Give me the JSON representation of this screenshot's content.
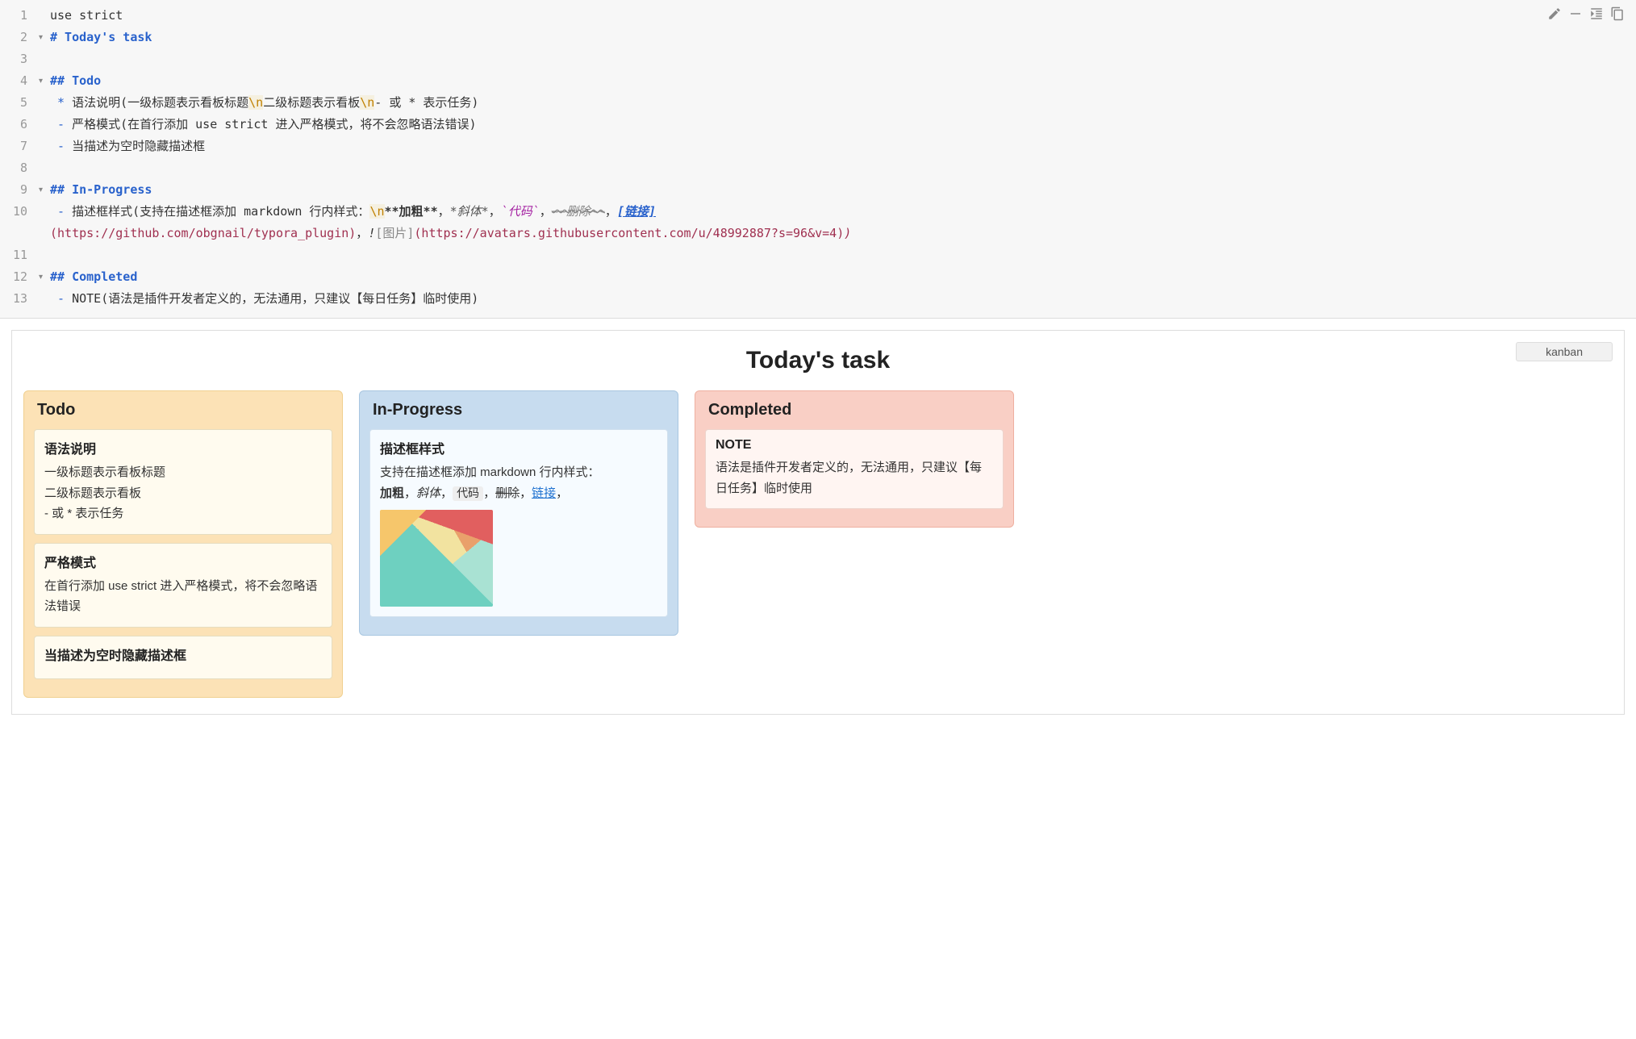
{
  "editor": {
    "lines": [
      {
        "num": "1",
        "fold": "",
        "segments": [
          {
            "cls": "tk-text",
            "t": "use strict"
          }
        ]
      },
      {
        "num": "2",
        "fold": "▾",
        "segments": [
          {
            "cls": "tk-header",
            "t": "# Today's task"
          }
        ]
      },
      {
        "num": "3",
        "fold": "",
        "segments": [
          {
            "cls": "tk-text",
            "t": ""
          }
        ]
      },
      {
        "num": "4",
        "fold": "▾",
        "segments": [
          {
            "cls": "tk-header",
            "t": "## Todo"
          }
        ]
      },
      {
        "num": "5",
        "fold": "",
        "segments": [
          {
            "cls": "tk-bullet",
            "t": " * "
          },
          {
            "cls": "tk-text",
            "t": "语法说明(一级标题表示看板标题"
          },
          {
            "cls": "tk-escape",
            "t": "\\n"
          },
          {
            "cls": "tk-text",
            "t": "二级标题表示看板"
          },
          {
            "cls": "tk-escape",
            "t": "\\n"
          },
          {
            "cls": "tk-text",
            "t": "- 或 * 表示任务)"
          }
        ]
      },
      {
        "num": "6",
        "fold": "",
        "segments": [
          {
            "cls": "tk-bullet",
            "t": " - "
          },
          {
            "cls": "tk-text",
            "t": "严格模式(在首行添加 use strict 进入严格模式，将不会忽略语法错误)"
          }
        ]
      },
      {
        "num": "7",
        "fold": "",
        "segments": [
          {
            "cls": "tk-bullet",
            "t": " - "
          },
          {
            "cls": "tk-text",
            "t": "当描述为空时隐藏描述框"
          }
        ]
      },
      {
        "num": "8",
        "fold": "",
        "segments": [
          {
            "cls": "tk-text",
            "t": ""
          }
        ]
      },
      {
        "num": "9",
        "fold": "▾",
        "segments": [
          {
            "cls": "tk-header",
            "t": "## In-Progress"
          }
        ]
      },
      {
        "num": "10",
        "fold": "",
        "segments": [
          {
            "cls": "tk-bullet",
            "t": " - "
          },
          {
            "cls": "tk-text",
            "t": "描述框样式(支持在描述框添加 markdown 行内样式："
          },
          {
            "cls": "tk-escape",
            "t": "\\n"
          },
          {
            "cls": "tk-bold",
            "t": "**加粗**"
          },
          {
            "cls": "tk-text",
            "t": "，"
          },
          {
            "cls": "tk-italic",
            "t": "*斜体*"
          },
          {
            "cls": "tk-text",
            "t": "，"
          },
          {
            "cls": "tk-code-inline",
            "t": "`代码`"
          },
          {
            "cls": "tk-text",
            "t": "，"
          },
          {
            "cls": "tk-strike",
            "t": "~~删除~~"
          },
          {
            "cls": "tk-text",
            "t": "，"
          },
          {
            "cls": "tk-link-label",
            "t": "[链接]"
          }
        ]
      },
      {
        "num": "",
        "fold": "",
        "segments": [
          {
            "cls": "tk-url",
            "t": "(https://github.com/obgnail/typora_plugin)"
          },
          {
            "cls": "tk-text",
            "t": "，"
          },
          {
            "cls": "tk-bang",
            "t": "!"
          },
          {
            "cls": "tk-img-label",
            "t": "[图片]"
          },
          {
            "cls": "tk-url",
            "t": "(https://avatars.githubusercontent.com/u/48992887?s=96&v=4)"
          },
          {
            "cls": "tk-paren",
            "t": ")"
          }
        ]
      },
      {
        "num": "11",
        "fold": "",
        "segments": [
          {
            "cls": "tk-text",
            "t": ""
          }
        ]
      },
      {
        "num": "12",
        "fold": "▾",
        "segments": [
          {
            "cls": "tk-header",
            "t": "## Completed"
          }
        ]
      },
      {
        "num": "13",
        "fold": "",
        "segments": [
          {
            "cls": "tk-bullet",
            "t": " - "
          },
          {
            "cls": "tk-text",
            "t": "NOTE(语法是插件开发者定义的，无法通用，只建议【每日任务】临时使用)"
          }
        ]
      }
    ]
  },
  "toolbar_icons": [
    "edit-icon",
    "minus-icon",
    "indent-icon",
    "copy-icon"
  ],
  "preview": {
    "badge": "kanban",
    "title": "Today's task",
    "columns": [
      {
        "key": "todo",
        "title": "Todo",
        "cards": [
          {
            "title": "语法说明",
            "body_lines": [
              "一级标题表示看板标题",
              "二级标题表示看板",
              "- 或 * 表示任务"
            ]
          },
          {
            "title": "严格模式",
            "body_lines": [
              "在首行添加 use strict 进入严格模式，将不会忽略语法错误"
            ]
          },
          {
            "title": "当描述为空时隐藏描述框",
            "body_lines": []
          }
        ]
      },
      {
        "key": "progress",
        "title": "In-Progress",
        "cards": [
          {
            "title": "描述框样式",
            "body_rich": {
              "intro": "支持在描述框添加 markdown 行内样式：",
              "bold": "加粗",
              "sep": "，",
              "italic": "斜体",
              "code": "代码",
              "strike": "删除",
              "link": "链接",
              "tail": "，",
              "has_image": true
            }
          }
        ]
      },
      {
        "key": "done",
        "title": "Completed",
        "cards": [
          {
            "title": "NOTE",
            "body_lines": [
              "语法是插件开发者定义的，无法通用，只建议【每日任务】临时使用"
            ]
          }
        ]
      }
    ]
  }
}
